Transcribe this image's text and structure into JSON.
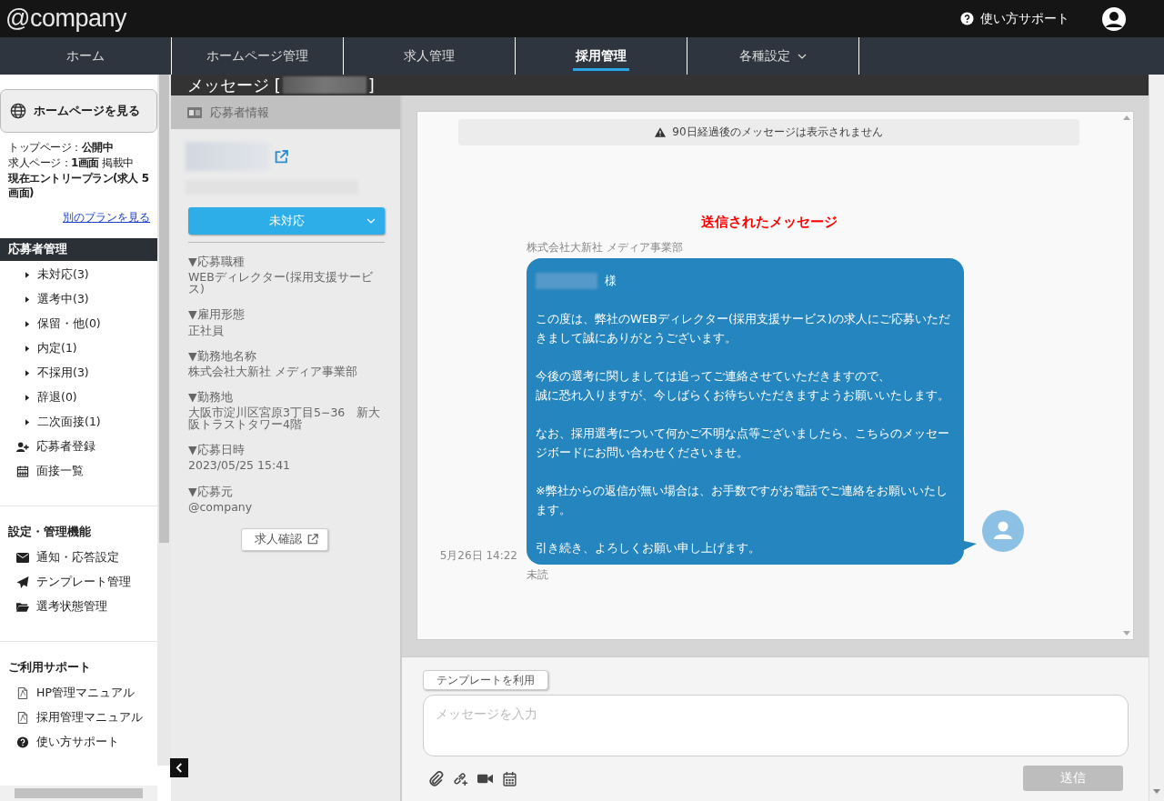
{
  "header": {
    "logo": "@company",
    "support": "使い方サポート"
  },
  "nav": [
    {
      "label": "ホーム",
      "selected": false,
      "dropdown": false
    },
    {
      "label": "ホームページ管理",
      "selected": false,
      "dropdown": false
    },
    {
      "label": "求人管理",
      "selected": false,
      "dropdown": false
    },
    {
      "label": "採用管理",
      "selected": true,
      "dropdown": false
    },
    {
      "label": "各種設定",
      "selected": false,
      "dropdown": true
    }
  ],
  "sidebar": {
    "view_button": "ホームページを見る",
    "status_lines": [
      "トップページ：**公開中**",
      "求人ページ：**1画面** 掲載中",
      "**現在エントリープラン(求人 5画面)**"
    ],
    "plan_link": "別のプランを見る",
    "sections": [
      {
        "title": "応募者管理",
        "highlighted": true,
        "items": [
          {
            "kind": "status",
            "label": "未対応(3)"
          },
          {
            "kind": "status",
            "label": "選考中(3)"
          },
          {
            "kind": "status",
            "label": "保留・他(0)"
          },
          {
            "kind": "status",
            "label": "内定(1)"
          },
          {
            "kind": "status",
            "label": "不採用(3)"
          },
          {
            "kind": "status",
            "label": "辞退(0)"
          },
          {
            "kind": "status",
            "label": "二次面接(1)"
          },
          {
            "kind": "add-user",
            "label": "応募者登録"
          },
          {
            "kind": "calendar",
            "label": "面接一覧"
          }
        ]
      },
      {
        "title": "設定・管理機能",
        "highlighted": false,
        "items": [
          {
            "kind": "mail",
            "label": "通知・応答設定"
          },
          {
            "kind": "send",
            "label": "テンプレート管理"
          },
          {
            "kind": "folder",
            "label": "選考状態管理"
          }
        ]
      },
      {
        "title": "ご利用サポート",
        "highlighted": false,
        "items": [
          {
            "kind": "pdf",
            "label": "HP管理マニュアル"
          },
          {
            "kind": "pdf",
            "label": "採用管理マニュアル"
          },
          {
            "kind": "help",
            "label": "使い方サポート"
          }
        ]
      }
    ]
  },
  "page_title": {
    "prefix": "メッセージ [",
    "suffix": "]"
  },
  "applicant": {
    "heading": "応募者情報",
    "status": "未対応",
    "fields": [
      {
        "label": "▼応募職種",
        "value": "WEBディレクター(採用支援サービス)"
      },
      {
        "label": "▼雇用形態",
        "value": "正社員"
      },
      {
        "label": "▼勤務地名称",
        "value": "株式会社大新社 メディア事業部"
      },
      {
        "label": "▼勤務地",
        "value": "大阪市淀川区宮原3丁目5−36　新大阪トラストタワー4階"
      },
      {
        "label": "▼応募日時",
        "value": "2023/05/25 15:41"
      },
      {
        "label": "▼応募元",
        "value": "@company"
      }
    ],
    "job_button": "求人確認"
  },
  "chat": {
    "notice": "90日経過後のメッセージは表示されません",
    "section_title": "送信されたメッセージ",
    "sender": "株式会社大新社 メディア事業部",
    "salutation": "様",
    "paragraphs": [
      [
        "この度は、弊社のWEBディレクター(採用支援サービス)の求人にご応募いただきまして誠にありがとうございます。"
      ],
      [
        "今後の選考に関しましては追ってご連絡させていただきますので、",
        "誠に恐れ入りますが、今しばらくお待ちいただきますようお願いいたします。"
      ],
      [
        "なお、採用選考について何かご不明な点等ございましたら、こちらのメッセージボードにお問い合わせくださいませ。"
      ],
      [
        "※弊社からの返信が無い場合は、お手数ですがお電話でご連絡をお願いいたします。"
      ],
      [
        "引き続き、よろしくお願い申し上げます。"
      ]
    ],
    "time": "5月26日 14:22",
    "read_status": "未読"
  },
  "composer": {
    "template_button": "テンプレートを利用",
    "placeholder": "メッセージを入力",
    "send_button": "送信",
    "send_disabled": true
  }
}
